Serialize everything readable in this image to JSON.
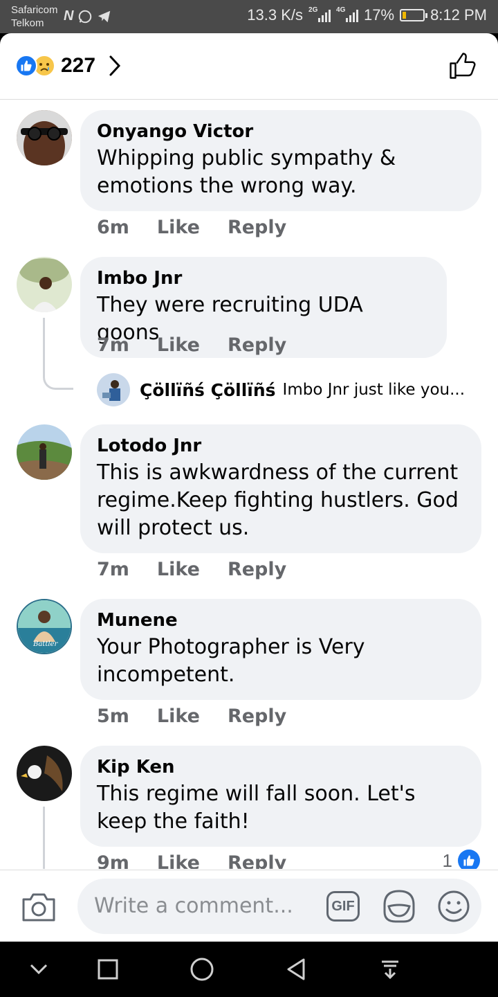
{
  "status_bar": {
    "carrier1": "Safaricom",
    "carrier2": "Telkom",
    "speed": "13.3 K/s",
    "sim1_tech": "2G",
    "sim2_tech": "4G",
    "battery_percent": "17%",
    "battery_level": 0.17,
    "time": "8:12 PM"
  },
  "header": {
    "reaction_count": "227",
    "reactions": [
      "like-icon",
      "sad-icon"
    ]
  },
  "comments": [
    {
      "author": "Onyango Victor",
      "text": "Whipping public sympathy & emotions the wrong way.",
      "time": "6m",
      "like_label": "Like",
      "reply_label": "Reply"
    },
    {
      "author": "Imbo Jnr",
      "text": "They were recruiting UDA goons",
      "time": "7m",
      "like_label": "Like",
      "reply_label": "Reply",
      "reply_preview": {
        "author": "Çöllïñś Çöllïñś",
        "text": "Imbo Jnr just like you..."
      }
    },
    {
      "author": "Lotodo Jnr",
      "text": "This is awkwardness of the current regime.Keep fighting hustlers. God will protect us.",
      "time": "7m",
      "like_label": "Like",
      "reply_label": "Reply"
    },
    {
      "author": "Munene",
      "text": "Your Photographer is Very incompetent.",
      "time": "5m",
      "like_label": "Like",
      "reply_label": "Reply",
      "avatar_caption": "Battler"
    },
    {
      "author": "Kip Ken",
      "text": "This regime will fall soon. Let's keep the faith!",
      "time": "9m",
      "like_label": "Like",
      "reply_label": "Reply",
      "likes": "1"
    }
  ],
  "composer": {
    "placeholder": "Write a comment...",
    "gif_label": "GIF"
  },
  "colors": {
    "accent": "#1877f2",
    "bubble": "#f0f2f5",
    "meta": "#65676b"
  }
}
